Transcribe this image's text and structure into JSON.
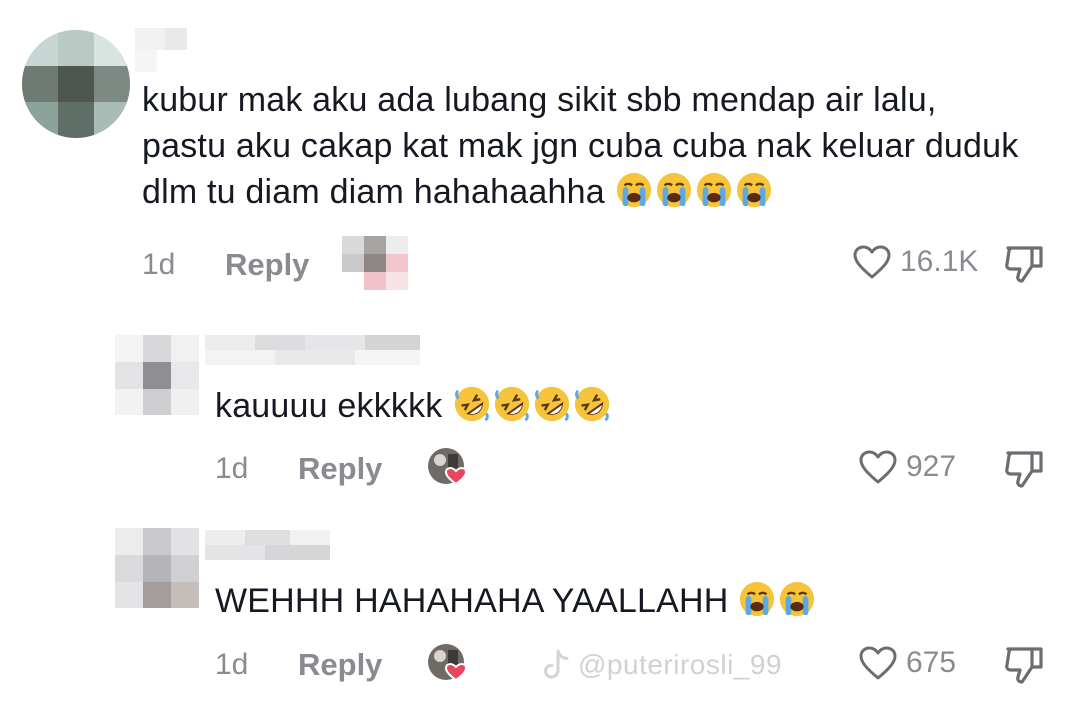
{
  "comments": [
    {
      "text_lines": [
        "kubur mak aku ada lubang sikit sbb mendap air lalu,",
        "pastu aku cakap kat mak jgn cuba cuba nak keluar duduk",
        "dlm tu diam diam hahahaahha"
      ],
      "emojis": [
        "loudly-crying-face",
        "loudly-crying-face",
        "loudly-crying-face",
        "loudly-crying-face"
      ],
      "time": "1d",
      "reply_label": "Reply",
      "likes": "16.1K"
    },
    {
      "text_lines": [
        "kauuuu ekkkkk"
      ],
      "emojis": [
        "rolling-on-floor-laughing",
        "rolling-on-floor-laughing",
        "rolling-on-floor-laughing",
        "rolling-on-floor-laughing"
      ],
      "time": "1d",
      "reply_label": "Reply",
      "likes": "927"
    },
    {
      "text_lines": [
        "WEHHH HAHAHAHA YAALLAHH"
      ],
      "emojis": [
        "loudly-crying-face",
        "loudly-crying-face"
      ],
      "time": "1d",
      "reply_label": "Reply",
      "likes": "675"
    }
  ],
  "watermark": "@puterirosli_99",
  "colors": {
    "text": "#161823",
    "meta": "#8a8b91",
    "heart": "#e8455f"
  }
}
